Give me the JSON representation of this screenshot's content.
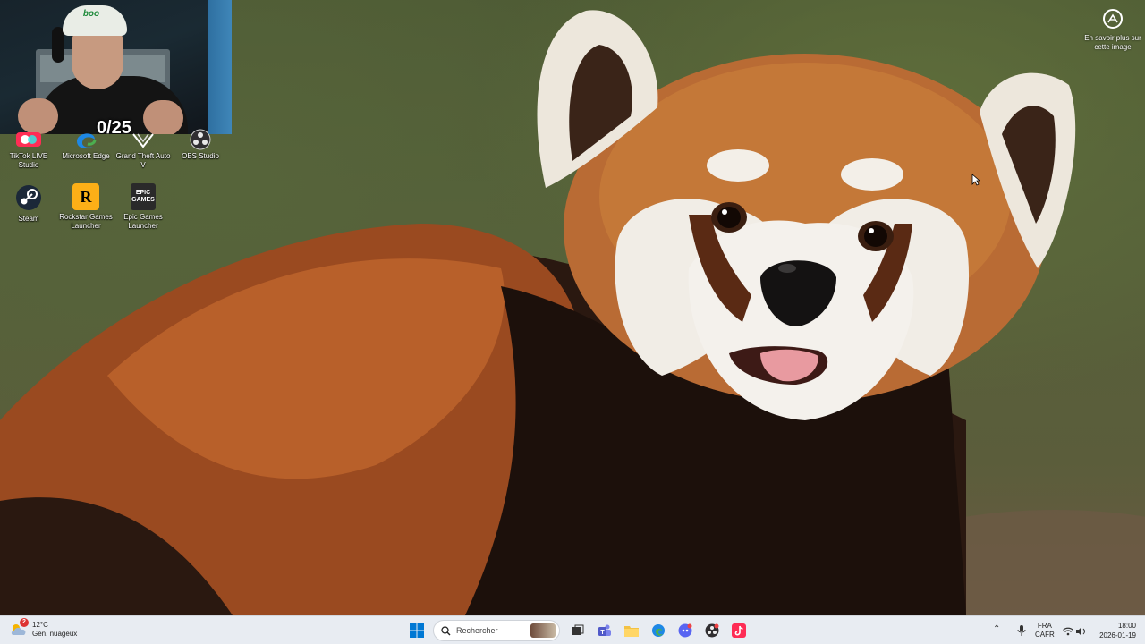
{
  "webcam": {
    "counter": "0/25",
    "cap_text": "boo"
  },
  "desktop_icons": [
    {
      "label": "TikTok LIVE Studio",
      "icon": "tiktok-live-icon"
    },
    {
      "label": "Microsoft Edge",
      "icon": "edge-icon"
    },
    {
      "label": "Grand Theft Auto V",
      "icon": "gta-v-icon"
    },
    {
      "label": "OBS Studio",
      "icon": "obs-icon"
    },
    {
      "label": "Steam",
      "icon": "steam-icon"
    },
    {
      "label": "Rockstar Games Launcher",
      "icon": "rockstar-icon",
      "glyph": "R"
    },
    {
      "label": "Epic Games Launcher",
      "icon": "epic-games-icon",
      "glyph": "EPIC\nGAMES"
    }
  ],
  "spotlight": {
    "label": "En savoir plus sur cette image"
  },
  "taskbar": {
    "weather": {
      "temp": "12°C",
      "condition": "Gén. nuageux",
      "badge": "2"
    },
    "search": {
      "placeholder": "Rechercher"
    },
    "apps": [
      "start-icon",
      "task-view-icon",
      "teams-icon",
      "file-explorer-icon",
      "edge-icon",
      "discord-icon",
      "obs-icon",
      "tiktok-icon"
    ],
    "tray": {
      "lang1": "FRA",
      "lang2": "CAFR",
      "time": "18:00",
      "date": "2026-01-19"
    }
  },
  "colors": {
    "taskbar_bg": "#e8ecf2",
    "panda_fur": "#b5602a",
    "windows_blue": "#0078d4"
  }
}
